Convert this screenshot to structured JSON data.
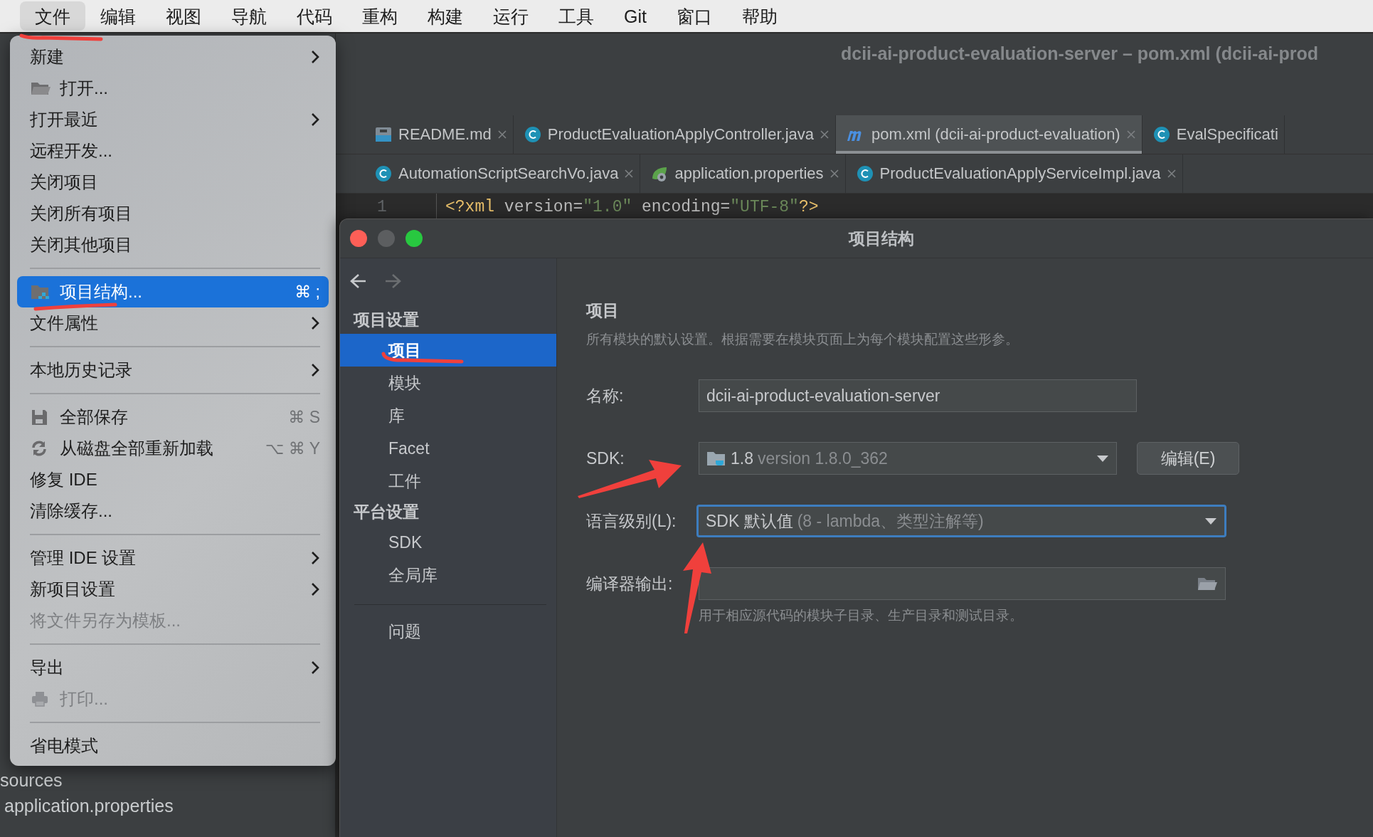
{
  "menu_bar": {
    "items": [
      {
        "label": "文件",
        "selected": true
      },
      {
        "label": "编辑",
        "selected": false
      },
      {
        "label": "视图",
        "selected": false
      },
      {
        "label": "导航",
        "selected": false
      },
      {
        "label": "代码",
        "selected": false
      },
      {
        "label": "重构",
        "selected": false
      },
      {
        "label": "构建",
        "selected": false
      },
      {
        "label": "运行",
        "selected": false
      },
      {
        "label": "工具",
        "selected": false
      },
      {
        "label": "Git",
        "selected": false
      },
      {
        "label": "窗口",
        "selected": false
      },
      {
        "label": "帮助",
        "selected": false
      }
    ]
  },
  "ide": {
    "title": "dcii-ai-product-evaluation-server – pom.xml (dcii-ai-prod",
    "tab_rows": [
      [
        {
          "label": "README.md",
          "selected": false
        },
        {
          "label": "ProductEvaluationApplyController.java",
          "selected": false
        },
        {
          "label": "pom.xml (dcii-ai-product-evaluation)",
          "selected": true
        },
        {
          "label": "EvalSpecificati",
          "selected": false
        }
      ],
      [
        {
          "label": "AutomationScriptSearchVo.java",
          "selected": false
        },
        {
          "label": "application.properties",
          "selected": false
        },
        {
          "label": "ProductEvaluationApplyServiceImpl.java",
          "selected": false
        }
      ]
    ],
    "code_lines": [
      {
        "number": "1",
        "tokens": [
          {
            "text": "<?xml ",
            "kind": "tag"
          },
          {
            "text": "version=",
            "kind": "attr"
          },
          {
            "text": "\"1.0\"",
            "kind": "string"
          },
          {
            "text": " encoding=",
            "kind": "attr"
          },
          {
            "text": "\"UTF-8\"",
            "kind": "string"
          },
          {
            "text": "?>",
            "kind": "tag"
          }
        ]
      }
    ],
    "project_tree": [
      {
        "label": "sources"
      },
      {
        "label": "application.properties"
      }
    ]
  },
  "file_menu": {
    "items": [
      {
        "kind": "item",
        "label": "新建",
        "submenu": true,
        "disabled": false,
        "selected": false
      },
      {
        "kind": "item",
        "label": "打开...",
        "submenu": false,
        "disabled": false,
        "selected": false
      },
      {
        "kind": "item",
        "label": "打开最近",
        "submenu": true,
        "disabled": false,
        "selected": false
      },
      {
        "kind": "item",
        "label": "远程开发...",
        "submenu": false,
        "disabled": false,
        "selected": false
      },
      {
        "kind": "item",
        "label": "关闭项目",
        "submenu": false,
        "disabled": false,
        "selected": false
      },
      {
        "kind": "item",
        "label": "关闭所有项目",
        "submenu": false,
        "disabled": false,
        "selected": false
      },
      {
        "kind": "item",
        "label": "关闭其他项目",
        "submenu": false,
        "disabled": false,
        "selected": false
      },
      {
        "kind": "separator"
      },
      {
        "kind": "item",
        "label": "项目结构...",
        "shortcut": "⌘ ;",
        "submenu": false,
        "disabled": false,
        "selected": true
      },
      {
        "kind": "item",
        "label": "文件属性",
        "submenu": true,
        "disabled": false,
        "selected": false
      },
      {
        "kind": "separator"
      },
      {
        "kind": "item",
        "label": "本地历史记录",
        "submenu": true,
        "disabled": false,
        "selected": false
      },
      {
        "kind": "separator"
      },
      {
        "kind": "item",
        "label": "全部保存",
        "shortcut": "⌘ S",
        "submenu": false,
        "disabled": false,
        "selected": false
      },
      {
        "kind": "item",
        "label": "从磁盘全部重新加载",
        "shortcut": "⌥ ⌘ Y",
        "submenu": false,
        "disabled": false,
        "selected": false
      },
      {
        "kind": "item",
        "label": "修复 IDE",
        "submenu": false,
        "disabled": false,
        "selected": false
      },
      {
        "kind": "item",
        "label": "清除缓存...",
        "submenu": false,
        "disabled": false,
        "selected": false
      },
      {
        "kind": "separator"
      },
      {
        "kind": "item",
        "label": "管理 IDE 设置",
        "submenu": true,
        "disabled": false,
        "selected": false
      },
      {
        "kind": "item",
        "label": "新项目设置",
        "submenu": true,
        "disabled": false,
        "selected": false
      },
      {
        "kind": "item",
        "label": "将文件另存为模板...",
        "submenu": false,
        "disabled": true,
        "selected": false
      },
      {
        "kind": "separator"
      },
      {
        "kind": "item",
        "label": "导出",
        "submenu": true,
        "disabled": false,
        "selected": false
      },
      {
        "kind": "item",
        "label": "打印...",
        "submenu": false,
        "disabled": true,
        "selected": false
      },
      {
        "kind": "separator"
      },
      {
        "kind": "item",
        "label": "省电模式",
        "submenu": false,
        "disabled": false,
        "selected": false
      }
    ]
  },
  "dialog": {
    "title": "项目结构",
    "nav": {
      "back_enabled": true,
      "forward_enabled": false
    },
    "sidebar": [
      {
        "kind": "header",
        "label": "项目设置"
      },
      {
        "kind": "item",
        "label": "项目",
        "selected": true
      },
      {
        "kind": "item",
        "label": "模块",
        "selected": false
      },
      {
        "kind": "item",
        "label": "库",
        "selected": false
      },
      {
        "kind": "item",
        "label": "Facet",
        "selected": false
      },
      {
        "kind": "item",
        "label": "工件",
        "selected": false
      },
      {
        "kind": "header",
        "label": "平台设置"
      },
      {
        "kind": "item",
        "label": "SDK",
        "selected": false
      },
      {
        "kind": "item",
        "label": "全局库",
        "selected": false
      },
      {
        "kind": "separator"
      },
      {
        "kind": "item",
        "label": "问题",
        "selected": false
      }
    ],
    "section_title": "项目",
    "description": "所有模块的默认设置。根据需要在模块页面上为每个模块配置这些形参。",
    "fields": [
      {
        "kind": "text",
        "label": "名称:",
        "value": "dcii-ai-product-evaluation-server",
        "focused": false
      },
      {
        "kind": "dropdown",
        "label": "SDK:",
        "value": "1.8",
        "hint": "version 1.8.0_362",
        "button": "编辑(E)",
        "focused": false
      },
      {
        "kind": "dropdown",
        "label": "语言级别(L):",
        "value": "SDK 默认值",
        "hint": "(8 - lambda、类型注解等)",
        "focused": true
      },
      {
        "kind": "path",
        "label": "编译器输出:",
        "help": "用于相应源代码的模块子目录、生产目录和测试目录。",
        "focused": false
      }
    ]
  }
}
